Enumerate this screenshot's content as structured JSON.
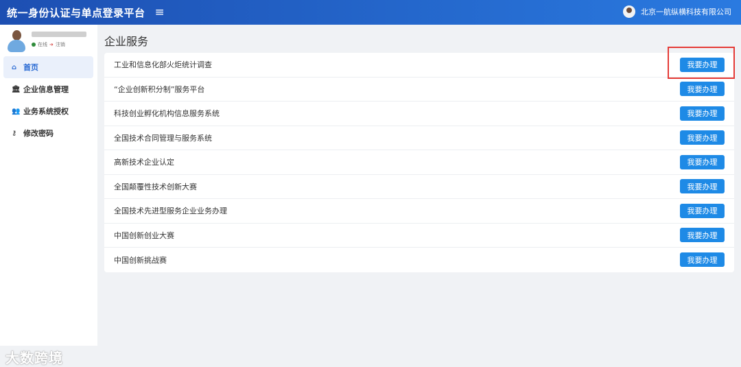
{
  "header": {
    "title": "统一身份认证与单点登录平台",
    "menu_icon": "≡",
    "company": "北京一航纵横科技有限公司"
  },
  "user": {
    "status": "在线",
    "logout": "注销"
  },
  "sidebar": {
    "items": [
      {
        "label": "首页",
        "icon": "home-icon",
        "glyph": "⌂",
        "active": true
      },
      {
        "label": "企业信息管理",
        "icon": "bank-icon",
        "glyph": "🏛"
      },
      {
        "label": "业务系统授权",
        "icon": "users-icon",
        "glyph": "👥"
      },
      {
        "label": "修改密码",
        "icon": "key-icon",
        "glyph": "⚷"
      }
    ]
  },
  "main": {
    "title": "企业服务",
    "button_label": "我要办理",
    "services": [
      "工业和信息化部火炬统计调查",
      "“企业创新积分制”服务平台",
      "科技创业孵化机构信息服务系统",
      "全国技术合同管理与服务系统",
      "高新技术企业认定",
      "全国颠覆性技术创新大赛",
      "全国技术先进型服务企业业务办理",
      "中国创新创业大赛",
      "中国创新挑战赛"
    ]
  },
  "watermark": "大数跨境"
}
